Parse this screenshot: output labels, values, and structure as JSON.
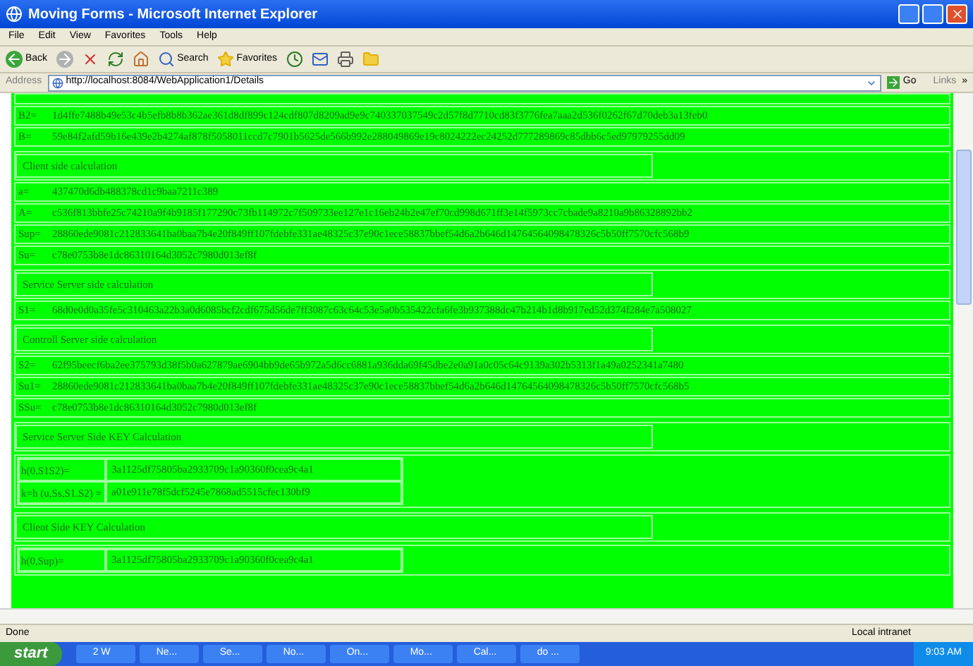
{
  "window": {
    "title": "Moving Forms - Microsoft Internet Explorer"
  },
  "menu": [
    "File",
    "Edit",
    "View",
    "Favorites",
    "Tools",
    "Help"
  ],
  "toolbar": {
    "back": "Back",
    "search": "Search",
    "favorites": "Favorites"
  },
  "address_bar": {
    "label": "Address",
    "url": "http://localhost:8084/WebApplication1/Details",
    "go": "Go",
    "links": "Links",
    "more": "»"
  },
  "rows": [
    {
      "kind": "pair",
      "label": "B2=",
      "value": "1d4ffe7488b49e53c4b5efb8b8b362ae361d8df899c124cdf807d8209ad9e9c740337037549c2d57f8d7710cd83f3776fea7aaa2d536f0262f67d70deb3a13feb0"
    },
    {
      "kind": "pair",
      "label": "B=",
      "value": "59e84f2afd59b16e439e2b4274af878f5058011ccd7c7901b5625de566b992e288049869e19c8024222ec24252d777289869c85dbb6c5ed97979255dd09"
    },
    {
      "kind": "header",
      "text": "Client side calculation"
    },
    {
      "kind": "pair",
      "label": "a=",
      "value": "437470d6db488378cd1c9baa7211c389"
    },
    {
      "kind": "pair",
      "label": "A=",
      "value": "c536f813bbfe25c74210a9f4b9185f177290c73fb114972c7f509733ee127e1c16eb24b2e47ef70cd998d671ff3e14f5973cc7cbade9a8210a9b86328892bb2"
    },
    {
      "kind": "pair",
      "label": "Sup=",
      "value": "28860ede9081c212833641ba0baa7b4e20f849ff107fdebfe331ae48325c37e90c1ece58837bbef54d6a2b646d14764564098478326c5b50ff7570cfc568b9"
    },
    {
      "kind": "pair",
      "label": "Su=",
      "value": "c78e0753b8e1dc86310164d3052c7980d013ef8f"
    },
    {
      "kind": "header",
      "text": "Service Server side calculation"
    },
    {
      "kind": "pair",
      "label": "S1=",
      "value": "68d0e0d0a35fe5c310463a22b3a0d6085bcf2cdf675d56de7ff3087c63c64c53e5a0b535422cfa6fe3b937388dc47b214b1d8b917ed52d374f284e7a508027"
    },
    {
      "kind": "header",
      "text": "Controll Server side calculation"
    },
    {
      "kind": "pair",
      "label": "S2=",
      "value": "62f95beecf6ba2ee375793d38f5b0a627879ae6904bb9de65b972a5d6cc6881a936dda69f45dbe2e0a91a0c05c64c9139a302b5313f1a49a0252341a7480"
    },
    {
      "kind": "pair",
      "label": "Su1=",
      "value": "28860ede9081c212833641ba0baa7b4e20f849ff107fdebfe331ae48325c37e90c1ece58837bbef54d6a2b646d14764564098478326c5b50ff7570cfc568b5"
    },
    {
      "kind": "pair",
      "label": "SSu=",
      "value": "c78e0753b8e1dc86310164d3052c7980d013ef8f"
    },
    {
      "kind": "header",
      "text": "Service Server Side KEY Calculation"
    },
    {
      "kind": "keytable",
      "pairs": [
        {
          "label": "h(0,S1S2)=",
          "value": "3a1125df75805ba2933709c1a90360f0cea9c4a1"
        },
        {
          "label": "k=h (u,Ss,S1.S2) =",
          "value": "a01e911e78f5dcf5245e7868ad5515cfec130bf9"
        }
      ]
    },
    {
      "kind": "header",
      "text": "Client Side KEY Calculation"
    },
    {
      "kind": "keytable",
      "pairs": [
        {
          "label": "h(0,Sup)=",
          "value": "3a1125df75805ba2933709c1a90360f0cea9c4a1"
        }
      ]
    }
  ],
  "status_bar": {
    "text": "Done",
    "zone": "Local intranet"
  },
  "taskbar": {
    "start": "start",
    "tasks": [
      "2 W",
      "Ne...",
      "Se...",
      "No...",
      "On...",
      "Mo...",
      "Cal...",
      "do ..."
    ],
    "clock": "9:03 AM"
  }
}
